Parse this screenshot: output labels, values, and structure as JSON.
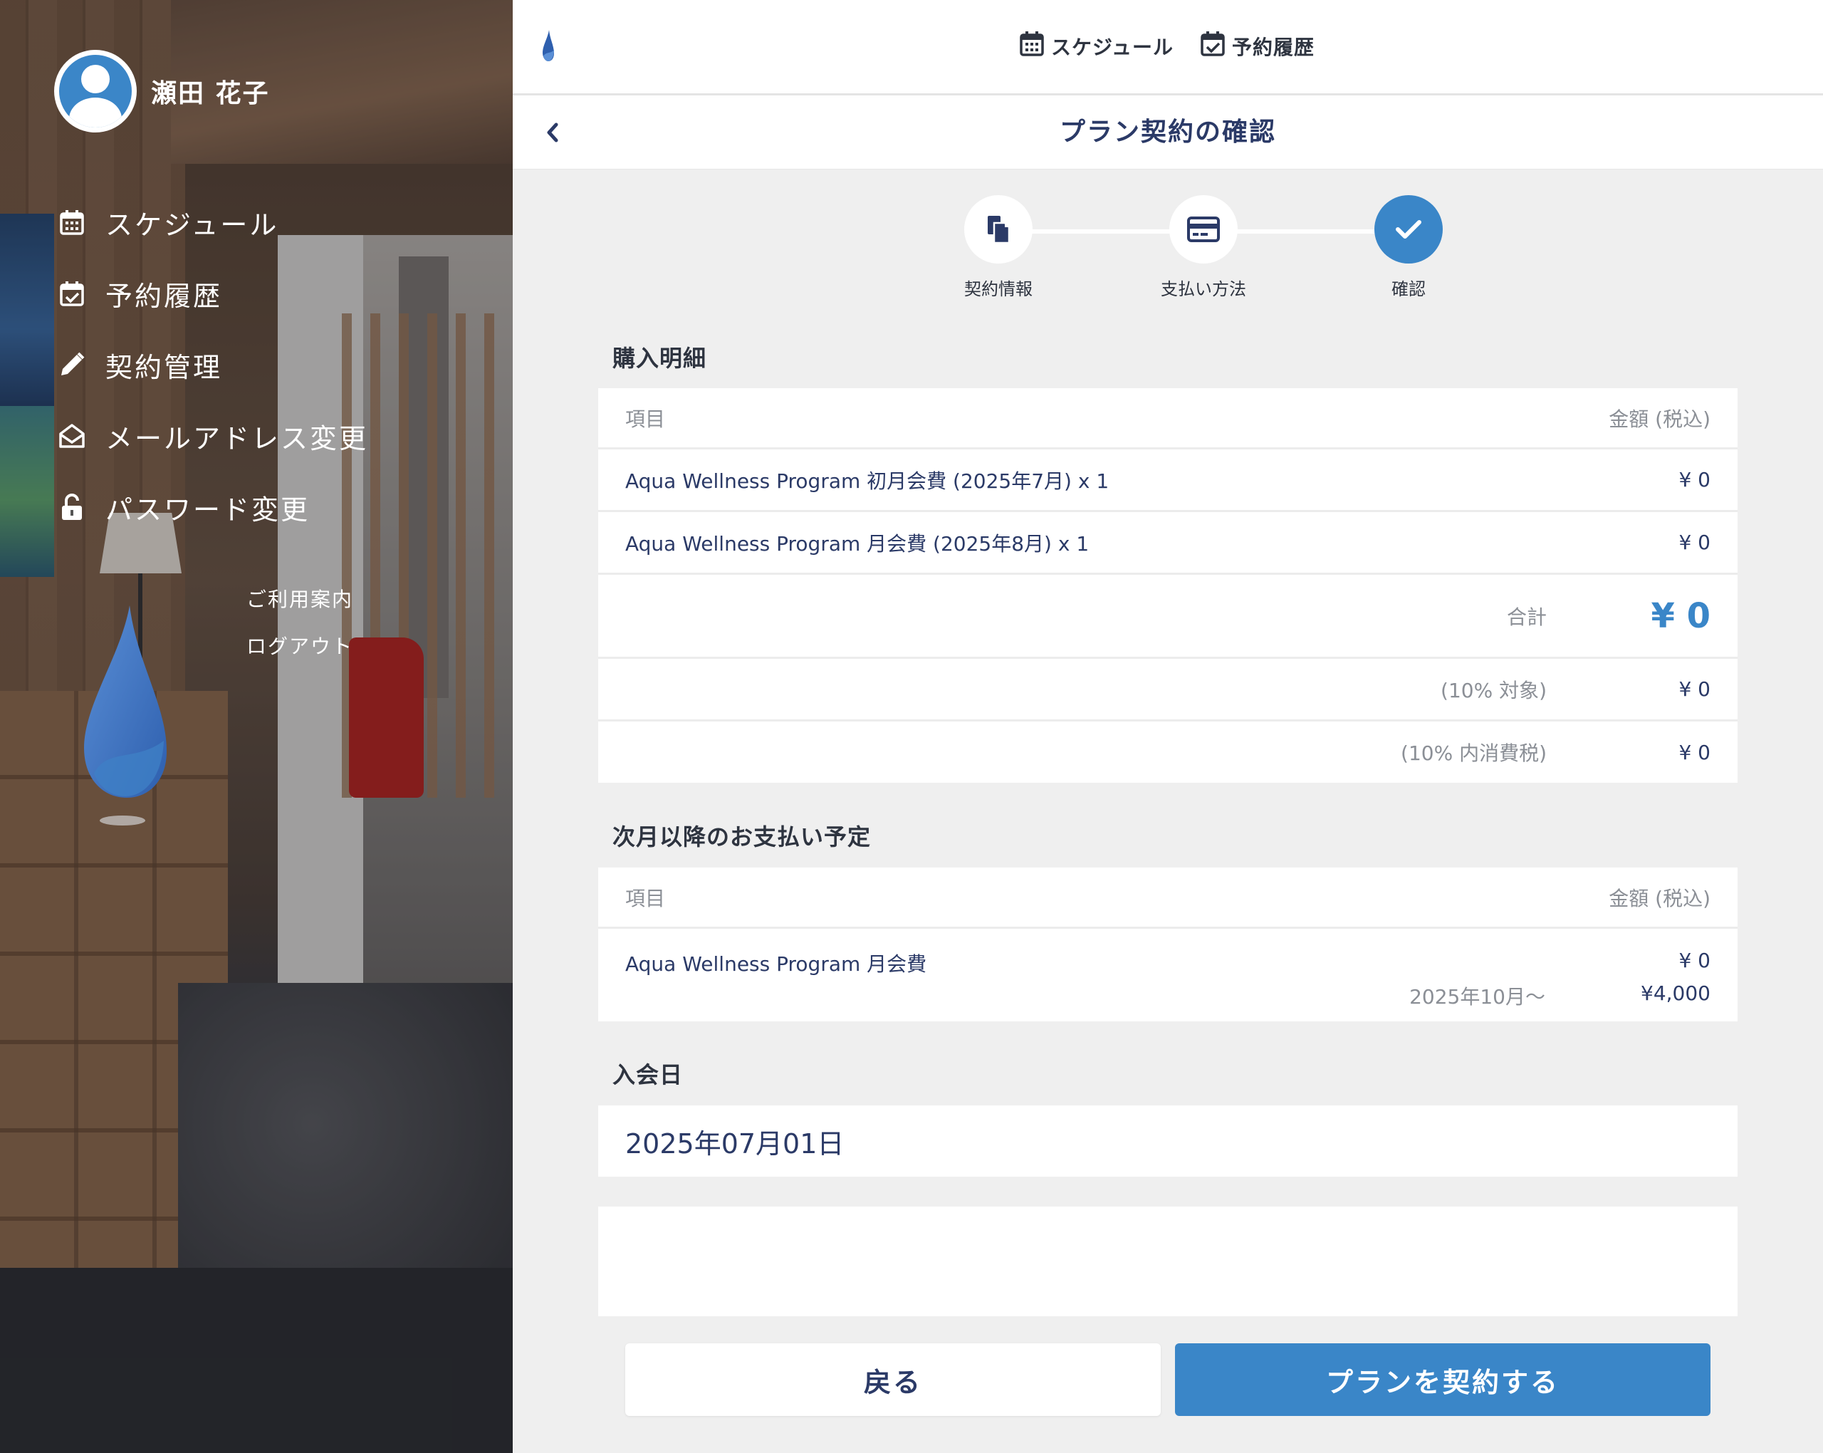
{
  "user": {
    "name": "瀬田 花子"
  },
  "sidebar": {
    "menu": [
      {
        "label": "スケジュール",
        "icon": "calendar-icon"
      },
      {
        "label": "予約履歴",
        "icon": "calendar-check-icon"
      },
      {
        "label": "契約管理",
        "icon": "pencil-icon"
      },
      {
        "label": "メールアドレス変更",
        "icon": "envelope-open-icon"
      },
      {
        "label": "パスワード変更",
        "icon": "unlock-icon"
      }
    ],
    "links": [
      "ご利用案内",
      "ログアウト"
    ]
  },
  "topnav": {
    "items": [
      {
        "label": "スケジュール",
        "icon": "calendar-icon"
      },
      {
        "label": "予約履歴",
        "icon": "calendar-check-icon"
      }
    ]
  },
  "page": {
    "title": "プラン契約の確認"
  },
  "stepper": {
    "steps": [
      {
        "label": "契約情報",
        "icon": "documents-icon",
        "active": false
      },
      {
        "label": "支払い方法",
        "icon": "credit-card-icon",
        "active": false
      },
      {
        "label": "確認",
        "icon": "check-icon",
        "active": true
      }
    ]
  },
  "purchase": {
    "title": "購入明細",
    "header_item": "項目",
    "header_amount": "金額 (税込)",
    "items": [
      {
        "name": "Aqua Wellness Program 初月会費 (2025年7月) x 1",
        "amount": "¥ 0"
      },
      {
        "name": "Aqua Wellness Program 月会費 (2025年8月) x 1",
        "amount": "¥ 0"
      }
    ],
    "total_label": "合計",
    "total_value": "¥ 0",
    "tax_target_label": "(10% 対象)",
    "tax_target_value": "¥ 0",
    "tax_included_label": "(10% 内消費税)",
    "tax_included_value": "¥ 0"
  },
  "upcoming": {
    "title": "次月以降のお支払い予定",
    "header_item": "項目",
    "header_amount": "金額 (税込)",
    "item_name": "Aqua Wellness Program 月会費",
    "item_amount": "¥ 0",
    "from_label": "2025年10月〜",
    "from_amount": "¥4,000"
  },
  "join_date": {
    "title": "入会日",
    "value": "2025年07月01日"
  },
  "buttons": {
    "back": "戻る",
    "submit": "プランを契約する"
  },
  "colors": {
    "accent": "#3a86c8",
    "text_primary": "#2b3a67",
    "muted": "#8b8f96",
    "background": "#efefef"
  }
}
